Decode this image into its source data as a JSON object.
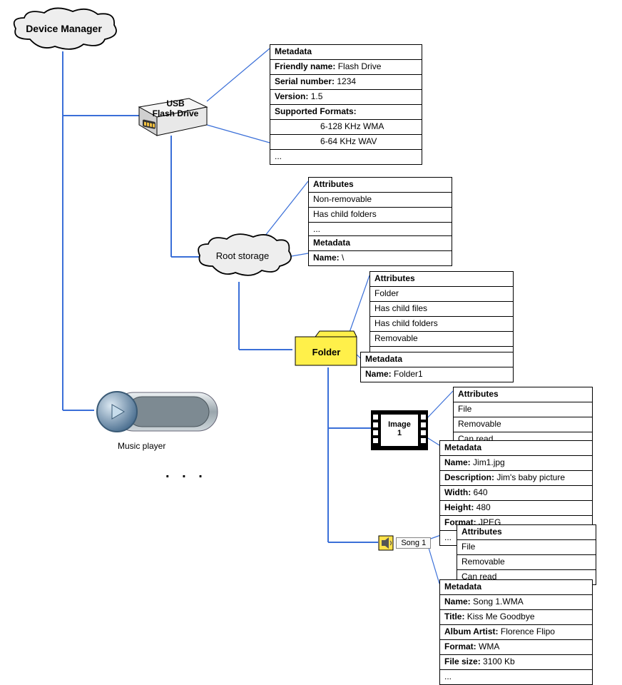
{
  "nodes": {
    "device_manager": "Device Manager",
    "usb": {
      "line1": "USB",
      "line2": "Flash Drive"
    },
    "root_storage": "Root storage",
    "folder": "Folder",
    "image": {
      "line1": "Image",
      "line2": "1"
    },
    "song": "Song 1",
    "music_player": "Music player",
    "ellipsis": ".   .   ."
  },
  "panels": {
    "usb_meta": {
      "title": "Metadata",
      "rows": [
        {
          "label": "Friendly name:",
          "value": " Flash Drive"
        },
        {
          "label": "Serial number:",
          "value": " 1234"
        },
        {
          "label": "Version:",
          "value": " 1.5"
        },
        {
          "label": "Supported Formats:",
          "value": ""
        },
        {
          "raw": "6-128 KHz WMA",
          "indent": true
        },
        {
          "raw": "6-64 KHz WAV",
          "indent": true
        },
        {
          "raw": "..."
        }
      ]
    },
    "root_attr": {
      "title": "Attributes",
      "rows": [
        {
          "raw": "Non-removable"
        },
        {
          "raw": "Has child folders"
        },
        {
          "raw": "..."
        }
      ]
    },
    "root_meta": {
      "title": "Metadata",
      "rows": [
        {
          "label": "Name:",
          "value": " \\"
        }
      ]
    },
    "folder_attr": {
      "title": "Attributes",
      "rows": [
        {
          "raw": "Folder"
        },
        {
          "raw": "Has child files"
        },
        {
          "raw": "Has child folders"
        },
        {
          "raw": "Removable"
        },
        {
          "raw": "..."
        }
      ]
    },
    "folder_meta": {
      "title": "Metadata",
      "rows": [
        {
          "label": "Name:",
          "value": " Folder1"
        }
      ]
    },
    "image_attr": {
      "title": "Attributes",
      "rows": [
        {
          "raw": "File"
        },
        {
          "raw": "Removable"
        },
        {
          "raw": "Can read"
        }
      ]
    },
    "image_meta": {
      "title": "Metadata",
      "rows": [
        {
          "label": "Name:",
          "value": " Jim1.jpg"
        },
        {
          "label": "Description:",
          "value": " Jim's baby picture"
        },
        {
          "label": "Width:",
          "value": " 640"
        },
        {
          "label": "Height:",
          "value": " 480"
        },
        {
          "label": "Format:",
          "value": " JPEG"
        },
        {
          "raw": "..."
        }
      ]
    },
    "song_attr": {
      "title": "Attributes",
      "rows": [
        {
          "raw": "File"
        },
        {
          "raw": "Removable"
        },
        {
          "raw": "Can read"
        }
      ]
    },
    "song_meta": {
      "title": "Metadata",
      "rows": [
        {
          "label": "Name:",
          "value": " Song 1.WMA"
        },
        {
          "label": "Title:",
          "value": " Kiss Me Goodbye"
        },
        {
          "label": "Album Artist:",
          "value": " Florence Flipo"
        },
        {
          "label": "Format:",
          "value": " WMA"
        },
        {
          "label": "File size:",
          "value": " 3100 Kb"
        },
        {
          "raw": "..."
        }
      ]
    }
  }
}
